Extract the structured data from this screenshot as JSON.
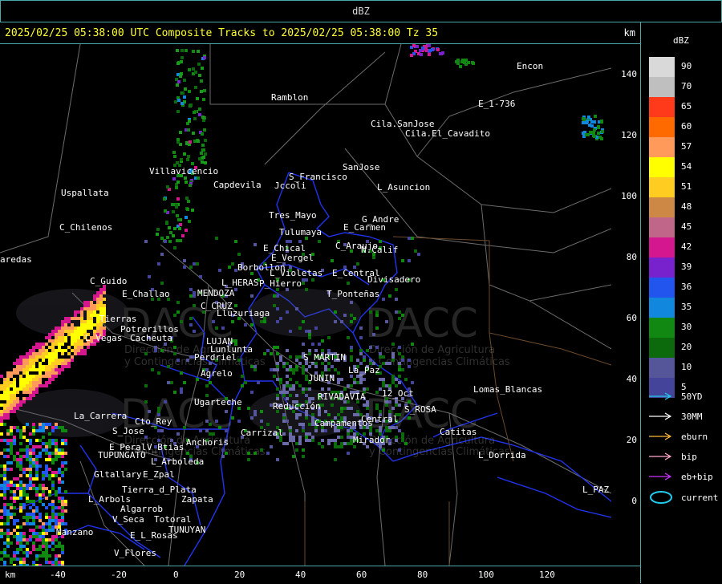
{
  "window_title": "dBZ",
  "header": {
    "title": "2025/02/25 05:38:00 UTC Composite Tracks to 2025/02/25 05:38:00 Tz 35",
    "unit": "km"
  },
  "y_axis": {
    "unit": "km",
    "ticks": [
      "140",
      "120",
      "100",
      "80",
      "60",
      "40",
      "20",
      "0"
    ]
  },
  "x_axis": {
    "unit": "km",
    "ticks": [
      "-40",
      "-20",
      "0",
      "20",
      "40",
      "60",
      "80",
      "100",
      "120"
    ]
  },
  "legend": {
    "title": "dBZ",
    "scale": [
      {
        "label": "90",
        "color": "#d9d9d9"
      },
      {
        "label": "70",
        "color": "#bfbfbf"
      },
      {
        "label": "65",
        "color": "#ff3a1a"
      },
      {
        "label": "60",
        "color": "#ff6a00"
      },
      {
        "label": "57",
        "color": "#ff9a5a"
      },
      {
        "label": "54",
        "color": "#ffff00"
      },
      {
        "label": "51",
        "color": "#ffcc22"
      },
      {
        "label": "48",
        "color": "#cc8844"
      },
      {
        "label": "45",
        "color": "#c06688"
      },
      {
        "label": "42",
        "color": "#d4168f"
      },
      {
        "label": "39",
        "color": "#7722cc"
      },
      {
        "label": "36",
        "color": "#2255ee"
      },
      {
        "label": "35",
        "color": "#1188dd"
      },
      {
        "label": "30",
        "color": "#118811"
      },
      {
        "label": "20",
        "color": "#0c6a0c"
      },
      {
        "label": "10",
        "color": "#555599"
      },
      {
        "label": "5",
        "color": "#44449a"
      }
    ],
    "tracks": [
      {
        "label": "50YD",
        "color": "#22ccee"
      },
      {
        "label": "30MM",
        "color": "#ffffff"
      },
      {
        "label": "eburn",
        "color": "#ffbb33"
      },
      {
        "label": "bip",
        "color": "#ffaacc"
      },
      {
        "label": "eb+bip",
        "color": "#cc33ff"
      }
    ],
    "current_label": "current",
    "current_color": "#22ccee"
  },
  "watermark": {
    "logo": "DACC",
    "line1": "Dirección de Agricultura",
    "line2": "y Contingencias Climáticas"
  },
  "places": [
    "Ramblon",
    "Cila.SanJose",
    "Cila.El_Cavadito",
    "Encon",
    "E_1-736",
    "SanJose",
    "L_Asuncion",
    "S_Francisco",
    "Jccoli",
    "Capdevila",
    "Villavicencio",
    "Uspallata",
    "C_Chilenos",
    "Tres_Mayo",
    "Tulumaya",
    "G_Andre",
    "E_Carmen",
    "C_Araujo",
    "N.Calif",
    "E_Chical",
    "E_Vergel",
    "Borbollon",
    "P_Hierro",
    "L_Violetas",
    "E_Central",
    "Divisadero",
    "C_Guido",
    "E_Challao",
    "MENDOZA",
    "L_HERAS",
    "C_CRUZ",
    "Lluzuriaga",
    "T_Ponteñas",
    "Potrerillos",
    "Cacheuta",
    "L_Vegas",
    "LUJAN",
    "Lunlunta",
    "Perdriel",
    "Agrelo",
    "Ugarteche",
    "S_MARTIN",
    "RIVADAVIA",
    "JUNIN",
    "La_Paz",
    "Lomas_Blancas",
    "S_ROSA",
    "Catitas",
    "Mirador",
    "Campamentos",
    "Reducción",
    "L_Dorrida",
    "La_Carrera",
    "Cto_Rey",
    "S_Jose",
    "E_Peral",
    "V_Btias",
    "TUPUNGATO",
    "L_Arboleda",
    "Gltallary",
    "E_Zpal",
    "Zapata",
    "Tierra_d_Plata",
    "L_Arbols",
    "Algarrob",
    "V_Seca",
    "Totoral",
    "TUNUYAN",
    "Manzano",
    "E_L_Rosas",
    "V_Flores",
    "Anchoris",
    "Carrizal",
    "L_PAZ",
    "12_Oct",
    "Central",
    "aredas",
    "Tierras"
  ]
}
